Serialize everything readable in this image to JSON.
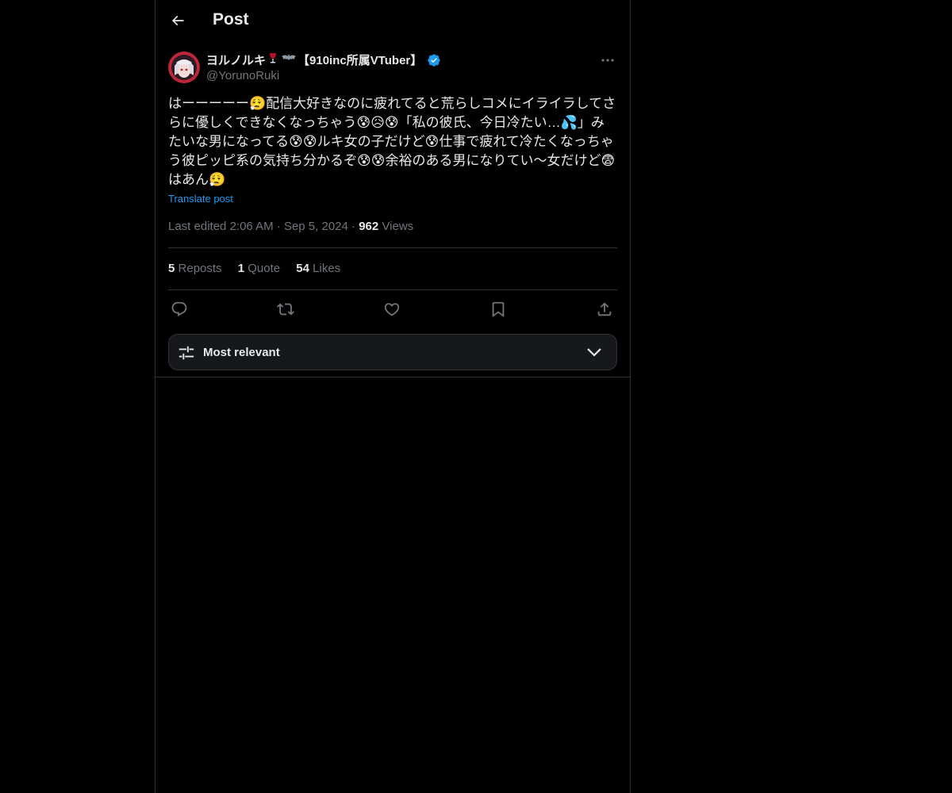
{
  "header": {
    "title": "Post",
    "back_icon": "arrow-left-icon"
  },
  "author": {
    "name_prefix": "ヨルノルキ",
    "name_suffix": "【910inc所属VTuber】",
    "emojis": [
      "wine-glass-emoji",
      "bat-emoji"
    ],
    "verified": true,
    "handle": "@YorunoRuki"
  },
  "post": {
    "text": "はーーーーー😮‍💨配信大好きなのに疲れてると荒らしコメにイライラしてさらに優しくできなくなっちゃう😰😥😰「私の彼氏、今日冷たい…💦」みたいな男になってる😰😰ルキ女の子だけど😰仕事で疲れて冷たくなっちゃう彼ピッピ系の気持ち分かるぞ😰😰余裕のある男になりてい〜女だけど😨はあん😮‍💨",
    "translate_label": "Translate post",
    "edited_label": "Last edited",
    "time": "2:06 AM",
    "date": "Sep 5, 2024",
    "views_count": "962",
    "views_label": "Views"
  },
  "stats": {
    "reposts_count": "5",
    "reposts_label": "Reposts",
    "quotes_count": "1",
    "quotes_label": "Quote",
    "likes_count": "54",
    "likes_label": "Likes"
  },
  "actions": [
    "reply-icon",
    "repost-icon",
    "like-icon",
    "bookmark-icon",
    "share-icon"
  ],
  "sort": {
    "label": "Most relevant"
  },
  "colors": {
    "background": "#000000",
    "text": "#e7e9ea",
    "muted": "#71767b",
    "accent": "#1d9bf0",
    "border": "#2f3336"
  }
}
